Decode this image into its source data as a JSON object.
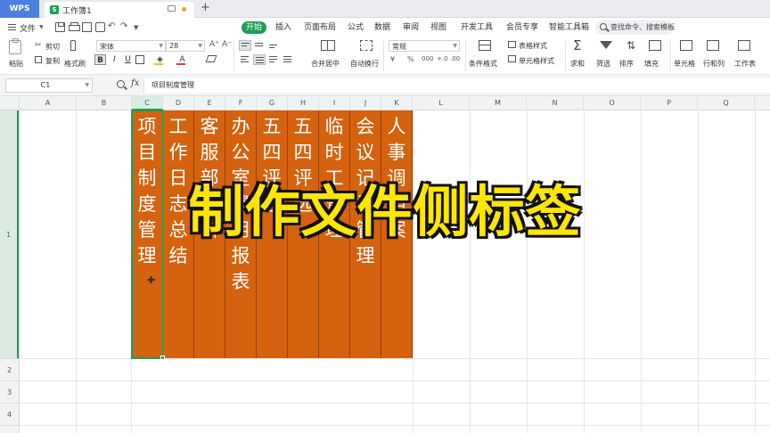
{
  "titlebar": {
    "app_name": "WPS",
    "doc_badge": "S",
    "doc_name": "工作簿1",
    "new_tab": "+"
  },
  "menubar": {
    "file_label": "文件",
    "tabs": [
      "开始",
      "插入",
      "页面布局",
      "公式",
      "数据",
      "审阅",
      "视图",
      "开发工具",
      "会员专享",
      "智能工具箱"
    ],
    "active_tab": "开始",
    "search_text": "查找命令、搜索模板"
  },
  "ribbon": {
    "paste": "粘贴",
    "cut": "剪切",
    "copy": "复制",
    "format_painter": "格式刷",
    "font_name": "宋体",
    "font_size": "28",
    "bold": "B",
    "italic": "I",
    "underline": "U",
    "merge_center": "合并居中",
    "wrap_text": "自动换行",
    "number_format": "常规",
    "currency": "¥",
    "percent": "%",
    "thousands": "000",
    "inc_decimal": "+.0",
    "dec_decimal": ".00",
    "conditional_format": "条件格式",
    "table_style": "表格样式",
    "cell_style": "单元格样式",
    "sum": "求和",
    "filter": "筛选",
    "sort": "排序",
    "fill": "填充",
    "cells": "单元格",
    "rows_cols": "行和列",
    "worksheet": "工作表"
  },
  "formula_bar": {
    "name_box": "C1",
    "fx": "fx",
    "content": "项目制度管理"
  },
  "grid": {
    "columns": [
      "A",
      "B",
      "C",
      "D",
      "E",
      "F",
      "G",
      "H",
      "I",
      "J",
      "K",
      "L",
      "M",
      "N",
      "O",
      "P",
      "Q"
    ],
    "selected_column": "C",
    "rows": [
      "1",
      "2",
      "3",
      "4"
    ],
    "selected_row": "1",
    "label_cells": [
      {
        "col": "C",
        "text": "项目制度管理"
      },
      {
        "col": "D",
        "text": "工作日志总结"
      },
      {
        "col": "E",
        "text": "客服部资料"
      },
      {
        "col": "F",
        "text": "办公室费用报表"
      },
      {
        "col": "G",
        "text": "五四评选"
      },
      {
        "col": "H",
        "text": "五四评选"
      },
      {
        "col": "I",
        "text": "临时工管理"
      },
      {
        "col": "J",
        "text": "会议记录管理"
      },
      {
        "col": "K",
        "text": "人事调档案"
      }
    ],
    "label_fill_color": "#d4620e",
    "selection_color": "#1e9e55"
  },
  "overlay": {
    "banner_text": "制作文件侧标签",
    "banner_color": "#ffe600"
  }
}
